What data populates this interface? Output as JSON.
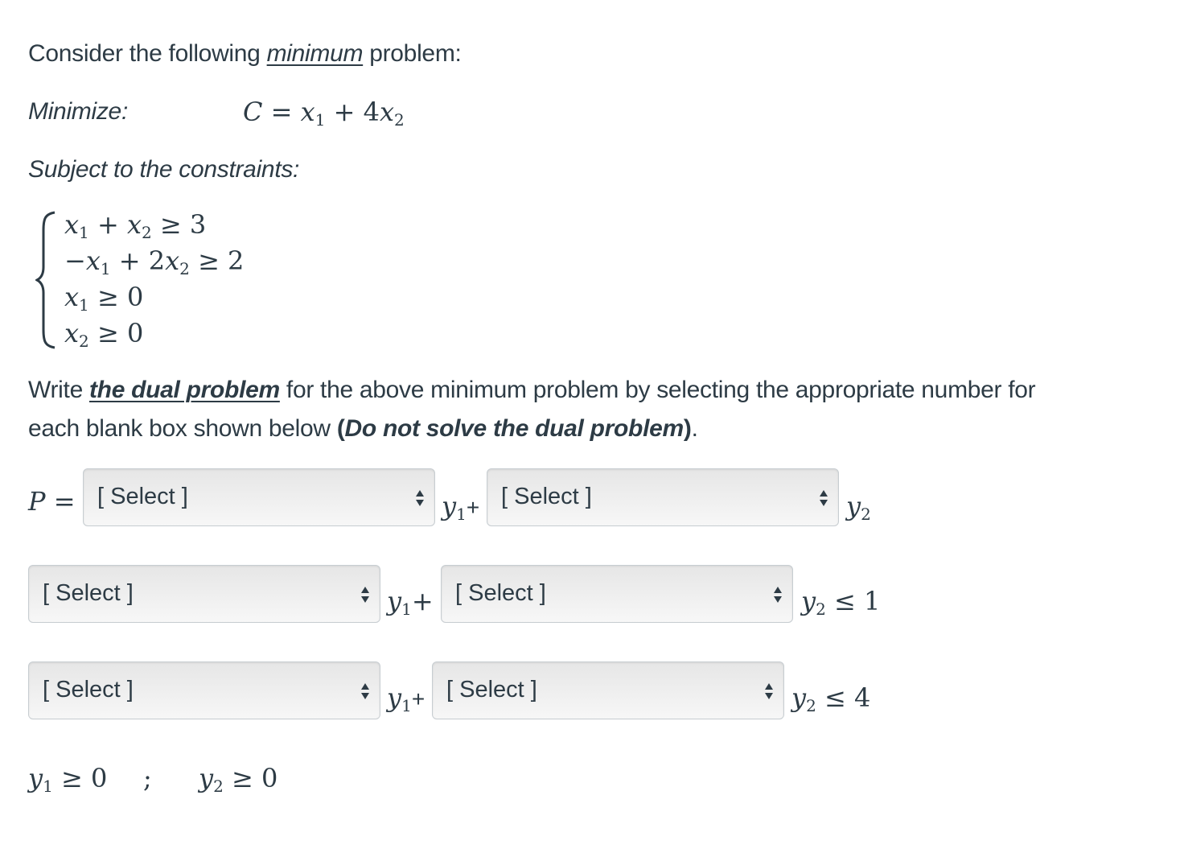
{
  "intro": {
    "prefix": "Consider the following ",
    "emph": "minimum",
    "suffix": " problem:"
  },
  "objective": {
    "label": "Minimize:",
    "var": "C",
    "expr": "C = x₁ + 4x₂"
  },
  "constraints_label": "Subject to the constraints:",
  "constraints": [
    "x₁ + x₂ ≥ 3",
    "−x₁ + 2x₂ ≥ 2",
    "x₁ ≥ 0",
    "x₂ ≥ 0"
  ],
  "instructions": {
    "line1_prefix": "Write ",
    "line1_emph": "the dual problem",
    "line1_suffix": " for the above minimum problem by selecting the appropriate number for",
    "line2_prefix": "each blank box shown below ",
    "line2_open": "(",
    "line2_bold": "Do not solve the dual problem",
    "line2_close": ")",
    "line2_end": "."
  },
  "dual": {
    "objective_var": "P",
    "rows": [
      {
        "select1": "[ Select ]",
        "select2": "[ Select ]",
        "tail": ""
      },
      {
        "select1": "[ Select ]",
        "select2": "[ Select ]",
        "tail": "≤ 1"
      },
      {
        "select1": "[ Select ]",
        "select2": "[ Select ]",
        "tail": "≤ 4"
      }
    ],
    "nonneg": [
      "y₁ ≥ 0",
      ";",
      "y₂ ≥ 0"
    ]
  }
}
